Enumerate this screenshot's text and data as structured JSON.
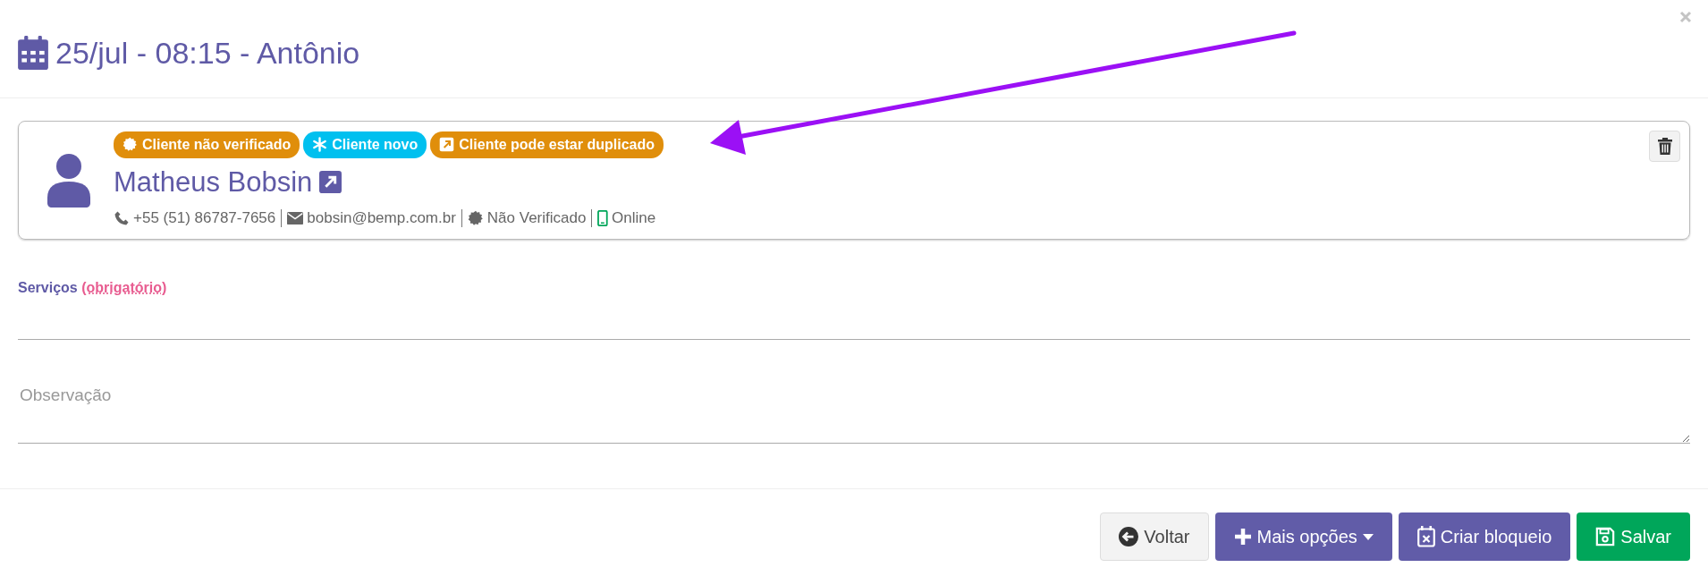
{
  "modal": {
    "title": "25/jul - 08:15 - Antônio"
  },
  "client": {
    "badges": [
      {
        "kind": "seal",
        "label": "Cliente não verificado",
        "color": "#e08e0b"
      },
      {
        "kind": "asterisk",
        "label": "Cliente novo",
        "color": "#00c0ef"
      },
      {
        "kind": "link",
        "label": "Cliente pode estar duplicado",
        "color": "#e08e0b"
      }
    ],
    "name": "Matheus Bobsin",
    "details": [
      {
        "kind": "phone",
        "text": "+55 (51) 86787-7656"
      },
      {
        "kind": "email",
        "text": "bobsin@bemp.com.br"
      },
      {
        "kind": "seal",
        "text": "Não Verificado"
      },
      {
        "kind": "mobile",
        "text": "Online"
      }
    ]
  },
  "services": {
    "label": "Serviços",
    "required": "(obrigatório)"
  },
  "notes": {
    "placeholder": "Observação"
  },
  "buttons": [
    {
      "kind": "back",
      "label": "Voltar"
    },
    {
      "kind": "more",
      "label": "Mais opções"
    },
    {
      "kind": "block",
      "label": "Criar bloqueio"
    },
    {
      "kind": "save",
      "label": "Salvar"
    }
  ]
}
